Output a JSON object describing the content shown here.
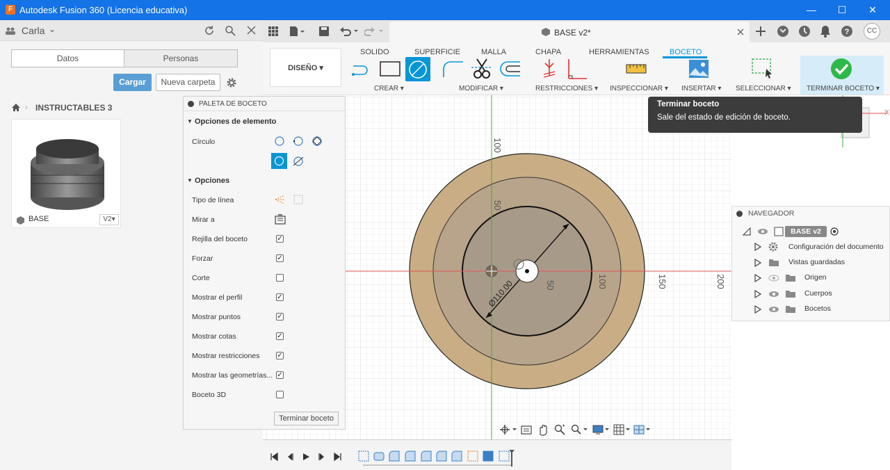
{
  "window": {
    "title": "Autodesk Fusion 360 (Licencia educativa)",
    "minimize": "—",
    "maximize": "☐",
    "close": "✕"
  },
  "left_panel": {
    "user": "Carla",
    "tabs": [
      "Datos",
      "Personas"
    ],
    "upload_label": "Cargar",
    "new_folder_label": "Nueva carpeta",
    "breadcrumb": "INSTRUCTABLES 3",
    "file": {
      "name": "BASE",
      "version": "V2▾"
    }
  },
  "document_tab": {
    "title": "BASE v2*",
    "avatar": "CC"
  },
  "workspace": {
    "label": "DISEÑO ▾"
  },
  "ribbon_tabs": [
    "SOLIDO",
    "SUPERFICIE",
    "MALLA",
    "CHAPA",
    "HERRAMIENTAS",
    "BOCETO"
  ],
  "ribbon_groups": [
    "CREAR ▾",
    "MODIFICAR ▾",
    "RESTRICCIONES ▾",
    "INSPECCIONAR ▾",
    "INSERTAR ▾",
    "SELECCIONAR ▾",
    "TERMINAR BOCETO ▾"
  ],
  "accent": "#0696d7",
  "palette": {
    "title": "PALETA DE BOCETO",
    "section1": "Opciones de elemento",
    "circle_label": "Círculo",
    "section2": "Opciones",
    "rows": [
      {
        "label": "Tipo de línea"
      },
      {
        "label": "Mirar a"
      },
      {
        "label": "Rejilla del boceto",
        "checked": true
      },
      {
        "label": "Forzar",
        "checked": true
      },
      {
        "label": "Corte",
        "checked": false
      },
      {
        "label": "Mostrar el perfil",
        "checked": true
      },
      {
        "label": "Mostrar puntos",
        "checked": true
      },
      {
        "label": "Mostrar cotas",
        "checked": true
      },
      {
        "label": "Mostrar restricciones",
        "checked": true
      },
      {
        "label": "Mostrar las geometrías...",
        "checked": true
      },
      {
        "label": "Boceto 3D",
        "checked": false
      }
    ],
    "finish_label": "Terminar boceto"
  },
  "tooltip": {
    "title": "Terminar boceto",
    "body": "Sale del estado de edición de boceto."
  },
  "navigator": {
    "title": "NAVEGADOR",
    "root": "BASE v2",
    "items": [
      "Configuración del documento",
      "Vistas guardadas",
      "Origen",
      "Cuerpos",
      "Bocetos"
    ]
  },
  "sketch": {
    "dimension": "Ø110.00",
    "grid_labels_x": [
      "50",
      "100",
      "150",
      "200"
    ],
    "grid_labels_y": [
      "100",
      "50"
    ],
    "axis_x_label": "X"
  }
}
